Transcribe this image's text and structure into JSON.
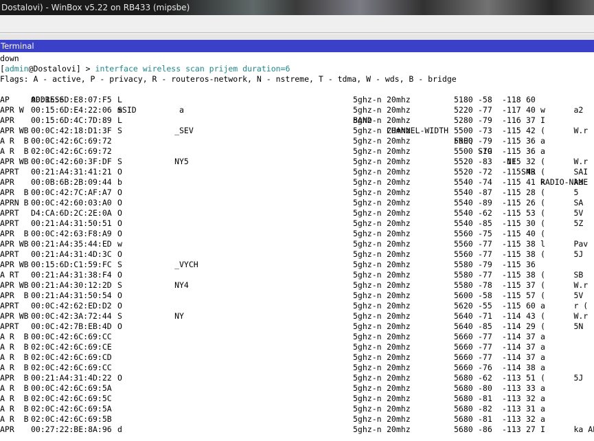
{
  "window": {
    "title": "Dostalovi) - WinBox v5.22 on RB433 (mipsbe)"
  },
  "terminal": {
    "header": "Terminal",
    "line_down": "down",
    "prompt": {
      "open": "[",
      "user": "admin",
      "at": "@",
      "host": "Dostalovi",
      "close": "] > ",
      "command": "interface wireless scan prijem duration=6"
    },
    "flags": "Flags: A - active, P - privacy, R - routeros-network, N - nstreme, T - tdma, W - wds, B - bridge",
    "columns": [
      "ADDRESS",
      "SSID",
      "BAND",
      "CHANNEL-WIDTH",
      "FREQ",
      "SIG",
      "NF",
      "SNR",
      "RADIO-NAME"
    ],
    "rows": [
      {
        "flags": "AP",
        "address": "00:15:6D:E8:07:F5",
        "ssid": "L",
        "band": "5ghz-n",
        "cw": "20mhz",
        "freq": "5180",
        "sig": "-58",
        "nf": "-118",
        "snr": "60",
        "radio": ""
      },
      {
        "flags": "APR W",
        "address": "00:15:6D:E4:22:06",
        "ssid": "m            a",
        "band": "5ghz-n",
        "cw": "20mhz",
        "freq": "5220",
        "sig": "-77",
        "nf": "-117",
        "snr": "40",
        "radio": "w      a2"
      },
      {
        "flags": "APR",
        "address": "00:15:6D:4C:7D:89",
        "ssid": "L",
        "band": "5ghz-n",
        "cw": "20mhz",
        "freq": "5280",
        "sig": "-79",
        "nf": "-116",
        "snr": "37",
        "radio": "I"
      },
      {
        "flags": "APR WB",
        "address": "00:0C:42:18:D1:3F",
        "ssid": "S           _SEV",
        "band": "5ghz-n",
        "cw": "20mhz",
        "freq": "5500",
        "sig": "-73",
        "nf": "-115",
        "snr": "42",
        "radio": "(      W.r"
      },
      {
        "flags": "A R  B",
        "address": "00:0C:42:6C:69:72",
        "ssid": "",
        "band": "5ghz-n",
        "cw": "20mhz",
        "freq": "5500",
        "sig": "-79",
        "nf": "-115",
        "snr": "36",
        "radio": "a"
      },
      {
        "flags": "A R  B",
        "address": "02:0C:42:6C:69:72",
        "ssid": "",
        "band": "5ghz-n",
        "cw": "20mhz",
        "freq": "5500",
        "sig": "-79",
        "nf": "-115",
        "snr": "36",
        "radio": "a"
      },
      {
        "flags": "APR WB",
        "address": "00:0C:42:60:3F:DF",
        "ssid": "S           NY5",
        "band": "5ghz-n",
        "cw": "20mhz",
        "freq": "5520",
        "sig": "-83",
        "nf": "-115",
        "snr": "32",
        "radio": "(      W.r"
      },
      {
        "flags": "APRT",
        "address": "00:21:A4:31:41:21",
        "ssid": "O",
        "band": "5ghz-n",
        "cw": "20mhz",
        "freq": "5520",
        "sig": "-72",
        "nf": "-115",
        "snr": "43",
        "radio": "(      SAI"
      },
      {
        "flags": "APR",
        "address": "00:0B:6B:2B:09:44",
        "ssid": "b",
        "band": "5ghz-n",
        "cw": "20mhz",
        "freq": "5540",
        "sig": "-74",
        "nf": "-115",
        "snr": "41",
        "radio": "k      ka"
      },
      {
        "flags": "APR  B",
        "address": "00:0C:42:7C:AF:A7",
        "ssid": "O",
        "band": "5ghz-n",
        "cw": "20mhz",
        "freq": "5540",
        "sig": "-87",
        "nf": "-115",
        "snr": "28",
        "radio": "(      5"
      },
      {
        "flags": "APRN B",
        "address": "00:0C:42:60:03:A0",
        "ssid": "O",
        "band": "5ghz-n",
        "cw": "20mhz",
        "freq": "5540",
        "sig": "-89",
        "nf": "-115",
        "snr": "26",
        "radio": "(      SA"
      },
      {
        "flags": "APRT",
        "address": "D4:CA:6D:2C:2E:0A",
        "ssid": "O",
        "band": "5ghz-n",
        "cw": "20mhz",
        "freq": "5540",
        "sig": "-62",
        "nf": "-115",
        "snr": "53",
        "radio": "(      5V"
      },
      {
        "flags": "APRT",
        "address": "00:21:A4:31:50:51",
        "ssid": "O",
        "band": "5ghz-n",
        "cw": "20mhz",
        "freq": "5540",
        "sig": "-85",
        "nf": "-115",
        "snr": "30",
        "radio": "(      5Z"
      },
      {
        "flags": "APR  B",
        "address": "00:0C:42:63:F8:A9",
        "ssid": "O",
        "band": "5ghz-n",
        "cw": "20mhz",
        "freq": "5560",
        "sig": "-75",
        "nf": "-115",
        "snr": "40",
        "radio": "("
      },
      {
        "flags": "APR WB",
        "address": "00:21:A4:35:44:ED",
        "ssid": "w",
        "band": "5ghz-n",
        "cw": "20mhz",
        "freq": "5560",
        "sig": "-77",
        "nf": "-115",
        "snr": "38",
        "radio": "l      Pav"
      },
      {
        "flags": "APRT",
        "address": "00:21:A4:31:4D:3C",
        "ssid": "O",
        "band": "5ghz-n",
        "cw": "20mhz",
        "freq": "5560",
        "sig": "-77",
        "nf": "-115",
        "snr": "38",
        "radio": "(      5J"
      },
      {
        "flags": "APR WB",
        "address": "00:15:6D:C1:59:FC",
        "ssid": "S           _VYCH",
        "band": "5ghz-n",
        "cw": "20mhz",
        "freq": "5580",
        "sig": "-79",
        "nf": "-115",
        "snr": "36",
        "radio": ""
      },
      {
        "flags": "A RT",
        "address": "00:21:A4:31:38:F4",
        "ssid": "O",
        "band": "5ghz-n",
        "cw": "20mhz",
        "freq": "5580",
        "sig": "-77",
        "nf": "-115",
        "snr": "38",
        "radio": "(      SB"
      },
      {
        "flags": "APR WB",
        "address": "00:21:A4:30:12:2D",
        "ssid": "S           NY4",
        "band": "5ghz-n",
        "cw": "20mhz",
        "freq": "5580",
        "sig": "-78",
        "nf": "-115",
        "snr": "37",
        "radio": "(      W.r"
      },
      {
        "flags": "APR  B",
        "address": "00:21:A4:31:50:54",
        "ssid": "O",
        "band": "5ghz-n",
        "cw": "20mhz",
        "freq": "5600",
        "sig": "-58",
        "nf": "-115",
        "snr": "57",
        "radio": "(      5V"
      },
      {
        "flags": "APRT",
        "address": "00:0C:42:62:ED:D2",
        "ssid": "O",
        "band": "5ghz-n",
        "cw": "20mhz",
        "freq": "5620",
        "sig": "-55",
        "nf": "-115",
        "snr": "60",
        "radio": "a      r ("
      },
      {
        "flags": "APR WB",
        "address": "00:0C:42:3A:72:44",
        "ssid": "S           NY",
        "band": "5ghz-n",
        "cw": "20mhz",
        "freq": "5640",
        "sig": "-71",
        "nf": "-114",
        "snr": "43",
        "radio": "(      W.r"
      },
      {
        "flags": "APRT",
        "address": "00:0C:42:7B:EB:4D",
        "ssid": "O",
        "band": "5ghz-n",
        "cw": "20mhz",
        "freq": "5640",
        "sig": "-85",
        "nf": "-114",
        "snr": "29",
        "radio": "(      5N"
      },
      {
        "flags": "A R  B",
        "address": "00:0C:42:6C:69:CC",
        "ssid": "",
        "band": "5ghz-n",
        "cw": "20mhz",
        "freq": "5660",
        "sig": "-77",
        "nf": "-114",
        "snr": "37",
        "radio": "a"
      },
      {
        "flags": "A R  B",
        "address": "02:0C:42:6C:69:CE",
        "ssid": "",
        "band": "5ghz-n",
        "cw": "20mhz",
        "freq": "5660",
        "sig": "-77",
        "nf": "-114",
        "snr": "37",
        "radio": "a"
      },
      {
        "flags": "A R  B",
        "address": "02:0C:42:6C:69:CD",
        "ssid": "",
        "band": "5ghz-n",
        "cw": "20mhz",
        "freq": "5660",
        "sig": "-77",
        "nf": "-114",
        "snr": "37",
        "radio": "a"
      },
      {
        "flags": "A R  B",
        "address": "02:0C:42:6C:69:CC",
        "ssid": "",
        "band": "5ghz-n",
        "cw": "20mhz",
        "freq": "5660",
        "sig": "-76",
        "nf": "-114",
        "snr": "38",
        "radio": "a"
      },
      {
        "flags": "APR  B",
        "address": "00:21:A4:31:4D:22",
        "ssid": "O",
        "band": "5ghz-n",
        "cw": "20mhz",
        "freq": "5680",
        "sig": "-62",
        "nf": "-113",
        "snr": "51",
        "radio": "(      5J"
      },
      {
        "flags": "A R  B",
        "address": "00:0C:42:6C:69:5A",
        "ssid": "",
        "band": "5ghz-n",
        "cw": "20mhz",
        "freq": "5680",
        "sig": "-80",
        "nf": "-113",
        "snr": "33",
        "radio": "a"
      },
      {
        "flags": "A R  B",
        "address": "02:0C:42:6C:69:5C",
        "ssid": "",
        "band": "5ghz-n",
        "cw": "20mhz",
        "freq": "5680",
        "sig": "-81",
        "nf": "-113",
        "snr": "32",
        "radio": "a"
      },
      {
        "flags": "A R  B",
        "address": "02:0C:42:6C:69:5A",
        "ssid": "",
        "band": "5ghz-n",
        "cw": "20mhz",
        "freq": "5680",
        "sig": "-82",
        "nf": "-113",
        "snr": "31",
        "radio": "a"
      },
      {
        "flags": "A R  B",
        "address": "02:0C:42:6C:69:5B",
        "ssid": "",
        "band": "5ghz-n",
        "cw": "20mhz",
        "freq": "5680",
        "sig": "-81",
        "nf": "-113",
        "snr": "32",
        "radio": "a"
      },
      {
        "flags": "APR",
        "address": "00:27:22:BE:8A:96",
        "ssid": "d",
        "band": "5ghz-n",
        "cw": "20mhz",
        "freq": "5680",
        "sig": "-86",
        "nf": "-113",
        "snr": "27",
        "radio": "I      ka AP"
      }
    ]
  },
  "colors": {
    "header_bg": "#3a40c8",
    "command": "#1c8a8a",
    "titlebar_bg": "#1a1a1a"
  }
}
